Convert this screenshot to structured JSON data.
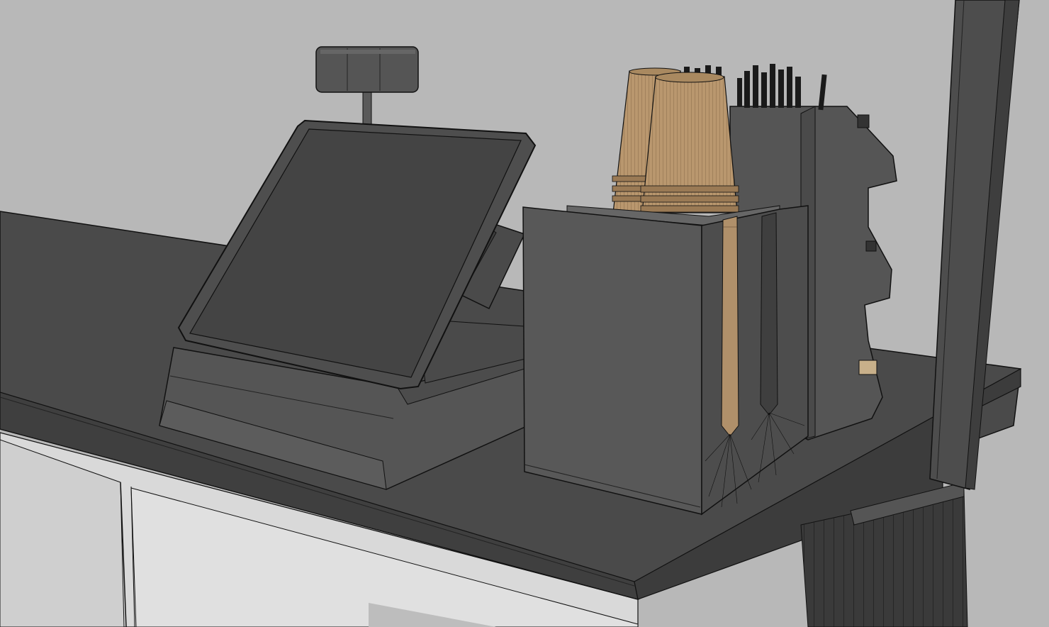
{
  "scene": {
    "subject": "pos-terminal-and-cup-dispenser-on-counter",
    "render_style": "wireframe-shaded",
    "colors": {
      "background": "#b8b8b8",
      "counter_top": "#4a4a4a",
      "counter_top_dark": "#3c3c3c",
      "counter_front": "#d6d6d6",
      "dispenser": "#585858",
      "dispenser_dark": "#4b4b4b",
      "monitor": "#4e4e4e",
      "screen": "#444444",
      "cup_kraft": "#b9976e",
      "cup_kraft_dark": "#9a7a55",
      "straws": "#1a1a1a",
      "outline": "#111111",
      "post": "#4d4d4d"
    }
  }
}
